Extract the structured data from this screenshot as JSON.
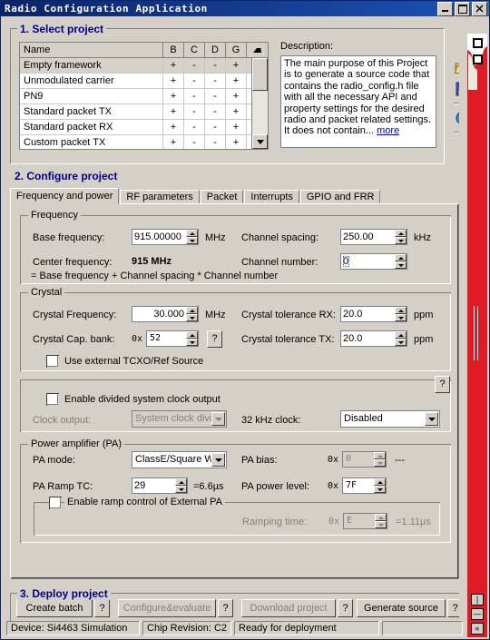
{
  "window": {
    "title": "Radio Configuration Application",
    "buttons": {
      "minimize": "_",
      "maximize": "□",
      "close": "✕"
    }
  },
  "step1": {
    "legend": "1. Select project",
    "grid": {
      "columns": [
        "Name",
        "B",
        "C",
        "D",
        "G"
      ],
      "rows": [
        {
          "name": "Empty framework",
          "b": "+",
          "c": "-",
          "d": "-",
          "g": "+",
          "selected": true
        },
        {
          "name": "Unmodulated carrier",
          "b": "+",
          "c": "-",
          "d": "-",
          "g": "+",
          "selected": false
        },
        {
          "name": "PN9",
          "b": "+",
          "c": "-",
          "d": "-",
          "g": "+",
          "selected": false
        },
        {
          "name": "Standard packet TX",
          "b": "+",
          "c": "-",
          "d": "-",
          "g": "+",
          "selected": false
        },
        {
          "name": "Standard packet RX",
          "b": "+",
          "c": "-",
          "d": "-",
          "g": "+",
          "selected": false
        },
        {
          "name": "Custom packet TX",
          "b": "+",
          "c": "-",
          "d": "-",
          "g": "+",
          "selected": false
        }
      ]
    },
    "description": {
      "label": "Description:",
      "text": "The main purpose of this Project is to generate a source code that contains the radio_config.h file with all the necessary API and property settings for the desired radio and packet related settings. It does not contain...",
      "more_link": "more"
    },
    "toolbar": {
      "open_icon": "open-folder-icon",
      "save_icon": "save-disk-icon",
      "help_icon": "help-question-icon"
    }
  },
  "step2": {
    "legend": "2. Configure project",
    "tabs": [
      {
        "label": "Frequency and power",
        "active": true
      },
      {
        "label": "RF parameters",
        "active": false
      },
      {
        "label": "Packet",
        "active": false
      },
      {
        "label": "Interrupts",
        "active": false
      },
      {
        "label": "GPIO and FRR",
        "active": false
      }
    ],
    "frequency": {
      "legend": "Frequency",
      "base_frequency_label": "Base frequency:",
      "base_frequency_value": "915.00000",
      "base_frequency_unit": "MHz",
      "channel_spacing_label": "Channel spacing:",
      "channel_spacing_value": "250.00",
      "channel_spacing_unit": "kHz",
      "center_frequency_label": "Center frequency:",
      "center_frequency_value": "915 MHz",
      "channel_number_label": "Channel number:",
      "channel_number_value": "0",
      "formula": "= Base frequency + Channel spacing * Channel number"
    },
    "crystal": {
      "legend": "Crystal",
      "freq_label": "Crystal Frequency:",
      "freq_value": "30.000",
      "freq_unit": "MHz",
      "cap_bank_label": "Crystal Cap. bank:",
      "cap_bank_prefix": "0x",
      "cap_bank_value": "52",
      "cap_bank_help": "?",
      "tol_rx_label": "Crystal tolerance RX:",
      "tol_rx_value": "20.0",
      "tol_rx_unit": "ppm",
      "tol_tx_label": "Crystal tolerance TX:",
      "tol_tx_value": "20.0",
      "tol_tx_unit": "ppm",
      "tcxo_checkbox_label": "Use external TCXO/Ref Source",
      "tcxo_checked": false
    },
    "clock": {
      "help": "?",
      "enable_label": "Enable divided system clock output",
      "enable_checked": false,
      "clock_output_label": "Clock output:",
      "clock_output_value": "System clock divid",
      "khz_label": "32 kHz clock:",
      "khz_value": "Disabled"
    },
    "pa": {
      "legend": "Power amplifier (PA)",
      "mode_label": "PA mode:",
      "mode_value": "ClassE/Square W",
      "bias_label": "PA bias:",
      "bias_prefix": "0x",
      "bias_value": "0",
      "bias_suffix": "---",
      "ramp_tc_label": "PA Ramp TC:",
      "ramp_tc_value": "29",
      "ramp_tc_suffix": "=6.6µs",
      "power_level_label": "PA power level:",
      "power_level_prefix": "0x",
      "power_level_value": "7F",
      "ext_pa_checkbox_label": "Enable ramp control of External PA",
      "ext_pa_checked": false,
      "ramping_time_label": "Ramping time:",
      "ramping_time_prefix": "0x",
      "ramping_time_value": "E",
      "ramping_time_suffix": "=1.11µs"
    }
  },
  "step3": {
    "legend": "3. Deploy project",
    "buttons": [
      {
        "label": "Create batch",
        "disabled": false,
        "help": "?"
      },
      {
        "label": "Configure&evaluate",
        "disabled": true,
        "help": "?"
      },
      {
        "label": "Download project",
        "disabled": true,
        "help": "?"
      },
      {
        "label": "Generate source",
        "disabled": false,
        "help": "?"
      }
    ]
  },
  "statusbar": {
    "device": "Device: Si4463  Simulation",
    "chip_revision": "Chip Revision: C2",
    "state": "Ready for deployment",
    "extra": ""
  },
  "side_panel": {
    "color": "#e01b24",
    "buttons": [
      "|",
      "—",
      "«"
    ]
  }
}
